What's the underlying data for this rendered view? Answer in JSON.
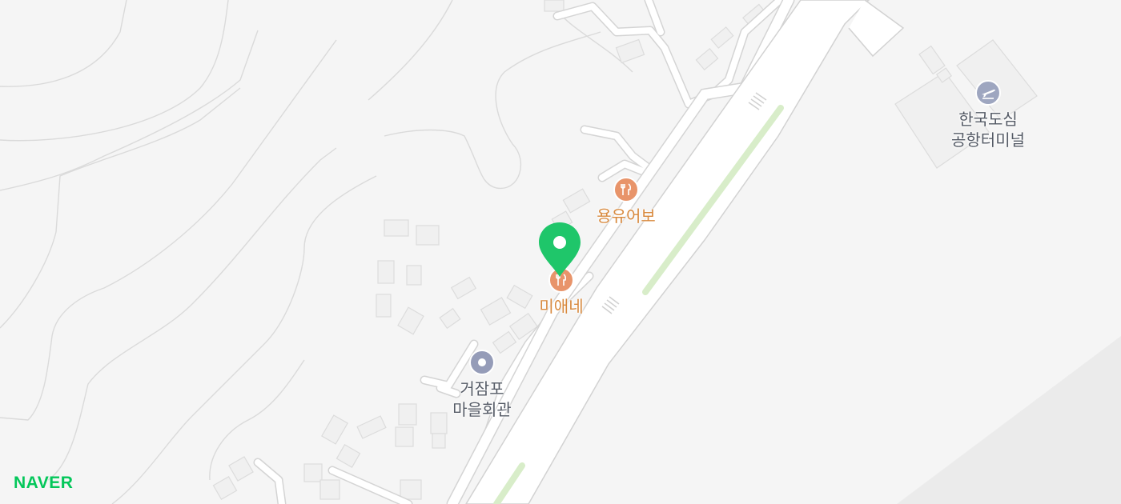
{
  "map": {
    "colors": {
      "background": "#f5f5f5",
      "road": "#ffffff",
      "road_edge": "#d6d6d6",
      "contour": "#d9d9d9",
      "green_strip": "#d8edc9",
      "sea": "#e8e8e8",
      "marker": "#1fc66a",
      "food_label": "#d8893d",
      "brand": "#03c75a"
    },
    "pois": [
      {
        "label_lines": [
          "용유어보"
        ],
        "icon": "fork-knife-icon",
        "category": "restaurant"
      },
      {
        "label_lines": [
          "미애네"
        ],
        "icon": "fork-knife-icon",
        "category": "restaurant",
        "selected": true
      },
      {
        "label_lines": [
          "거잠포",
          "마을회관"
        ],
        "icon": "dot-icon",
        "category": "public"
      },
      {
        "label_lines": [
          "한국도심",
          "공항터미널"
        ],
        "icon": "airplane-icon",
        "category": "airport"
      }
    ],
    "brand_logo": "NAVER"
  }
}
